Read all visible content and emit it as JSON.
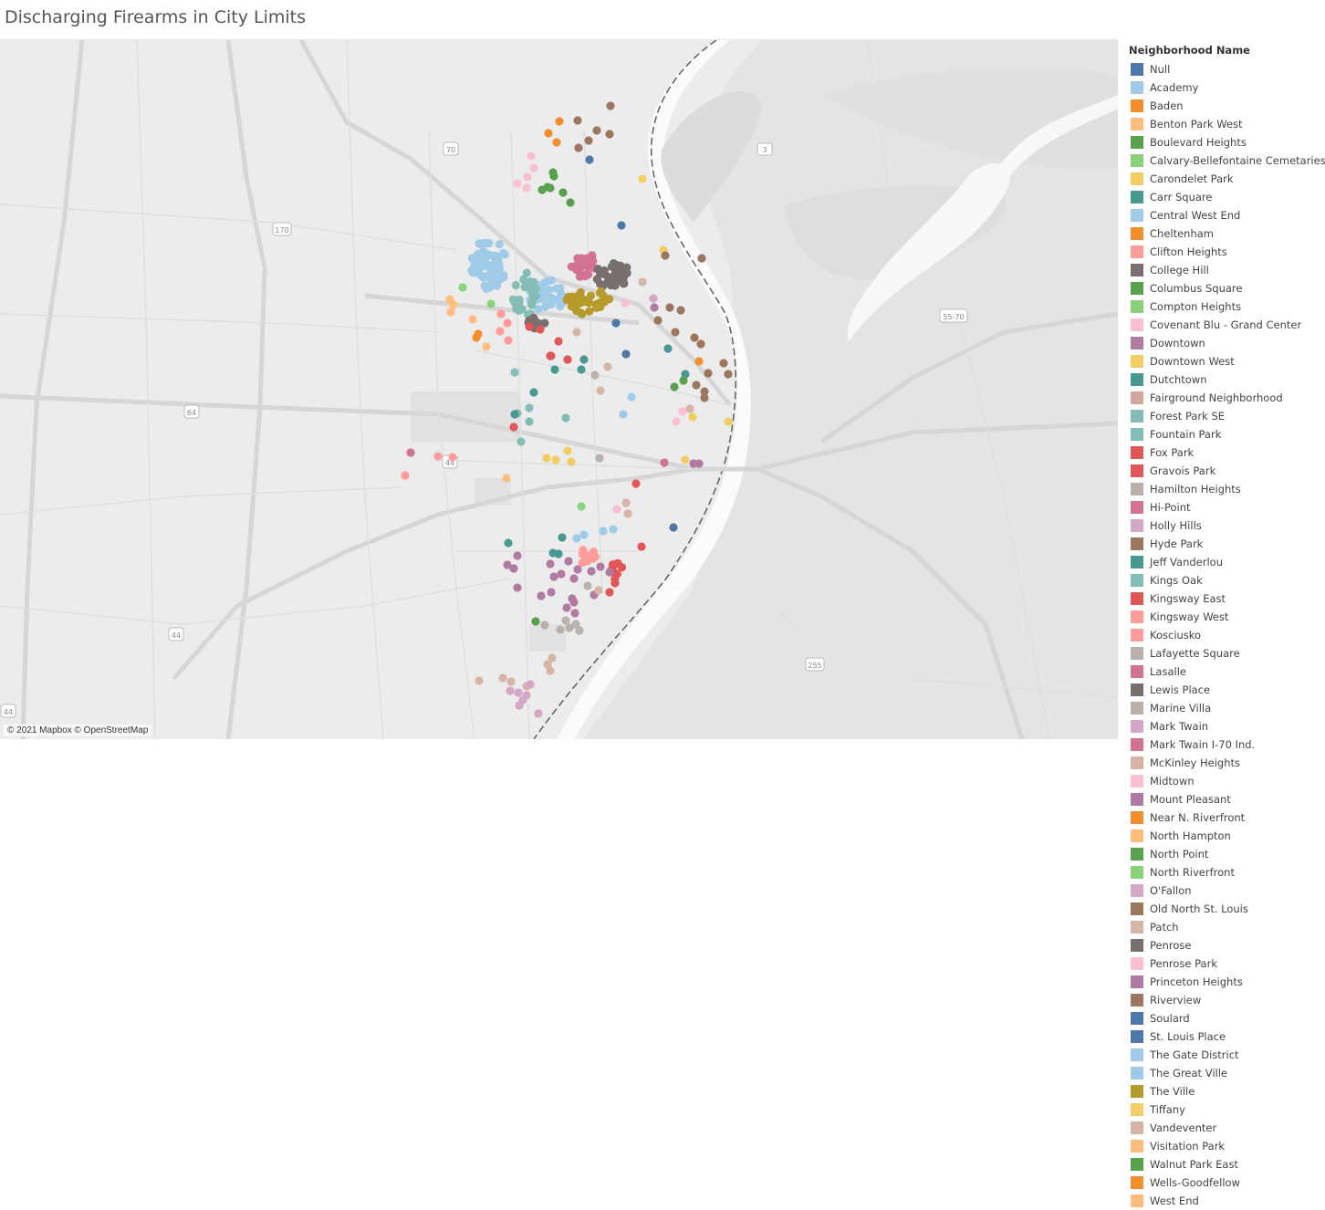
{
  "title": "Discharging Firearms in City Limits",
  "map": {
    "attribution": "© 2021 Mapbox © OpenStreetMap",
    "basemap_labels": {
      "i70": "70",
      "i170": "170",
      "i64": "64",
      "i44_west": "44",
      "i44_city": "44",
      "i44_edge": "44",
      "il3": "3",
      "i5570": "55-70",
      "i255": "255"
    }
  },
  "legend": {
    "title": "Neighborhood Name",
    "items": [
      {
        "label": "Null",
        "color": "#4e79a7"
      },
      {
        "label": "Academy",
        "color": "#a0cbe8"
      },
      {
        "label": "Baden",
        "color": "#f28e2b"
      },
      {
        "label": "Benton Park West",
        "color": "#ffbe7d"
      },
      {
        "label": "Boulevard Heights",
        "color": "#59a14f"
      },
      {
        "label": "Calvary-Bellefontaine Cemetaries",
        "color": "#8cd17d"
      },
      {
        "label": "Carondelet Park",
        "color": "#f1ce63"
      },
      {
        "label": "Carr Square",
        "color": "#499894"
      },
      {
        "label": "Central West End",
        "color": "#a0cbe8"
      },
      {
        "label": "Cheltenham",
        "color": "#f28e2b"
      },
      {
        "label": "Clifton Heights",
        "color": "#ff9d9a"
      },
      {
        "label": "College Hill",
        "color": "#79706e"
      },
      {
        "label": "Columbus Square",
        "color": "#59a14f"
      },
      {
        "label": "Compton Heights",
        "color": "#8cd17d"
      },
      {
        "label": "Covenant Blu - Grand Center",
        "color": "#fabfd2"
      },
      {
        "label": "Downtown",
        "color": "#b07aa1"
      },
      {
        "label": "Downtown West",
        "color": "#f1ce63"
      },
      {
        "label": "Dutchtown",
        "color": "#499894"
      },
      {
        "label": "Fairground Neighborhood",
        "color": "#d4a6a0"
      },
      {
        "label": "Forest Park SE",
        "color": "#86bcb6"
      },
      {
        "label": "Fountain Park",
        "color": "#86bcb6"
      },
      {
        "label": "Fox Park",
        "color": "#e15759"
      },
      {
        "label": "Gravois Park",
        "color": "#e15759"
      },
      {
        "label": "Hamilton Heights",
        "color": "#bab0ac"
      },
      {
        "label": "Hi-Point",
        "color": "#d37295"
      },
      {
        "label": "Holly Hills",
        "color": "#d4a6c8"
      },
      {
        "label": "Hyde Park",
        "color": "#9d7660"
      },
      {
        "label": "Jeff Vanderlou",
        "color": "#499894"
      },
      {
        "label": "Kings Oak",
        "color": "#86bcb6"
      },
      {
        "label": "Kingsway East",
        "color": "#e15759"
      },
      {
        "label": "Kingsway West",
        "color": "#ff9d9a"
      },
      {
        "label": "Kosciusko",
        "color": "#ff9d9a"
      },
      {
        "label": "Lafayette Square",
        "color": "#bab0ac"
      },
      {
        "label": "Lasalle",
        "color": "#d37295"
      },
      {
        "label": "Lewis Place",
        "color": "#79706e"
      },
      {
        "label": "Marine Villa",
        "color": "#bab0ac"
      },
      {
        "label": "Mark Twain",
        "color": "#d4a6c8"
      },
      {
        "label": "Mark Twain I-70 Ind.",
        "color": "#d37295"
      },
      {
        "label": "McKinley Heights",
        "color": "#d7b5a6"
      },
      {
        "label": "Midtown",
        "color": "#fabfd2"
      },
      {
        "label": "Mount Pleasant",
        "color": "#b07aa1"
      },
      {
        "label": "Near N. Riverfront",
        "color": "#f28e2b"
      },
      {
        "label": "North Hampton",
        "color": "#ffbe7d"
      },
      {
        "label": "North Point",
        "color": "#59a14f"
      },
      {
        "label": "North Riverfront",
        "color": "#8cd17d"
      },
      {
        "label": "O'Fallon",
        "color": "#d4a6c8"
      },
      {
        "label": "Old North St. Louis",
        "color": "#9d7660"
      },
      {
        "label": "Patch",
        "color": "#d7b5a6"
      },
      {
        "label": "Penrose",
        "color": "#79706e"
      },
      {
        "label": "Penrose Park",
        "color": "#fabfd2"
      },
      {
        "label": "Princeton Heights",
        "color": "#b07aa1"
      },
      {
        "label": "Riverview",
        "color": "#9d7660"
      },
      {
        "label": "Soulard",
        "color": "#4e79a7"
      },
      {
        "label": "St. Louis Place",
        "color": "#4e79a7"
      },
      {
        "label": "The Gate District",
        "color": "#a0cbe8"
      },
      {
        "label": "The Great Ville",
        "color": "#a0cbe8"
      },
      {
        "label": "The Ville",
        "color": "#b69a2c"
      },
      {
        "label": "Tiffany",
        "color": "#f1ce63"
      },
      {
        "label": "Vandeventer",
        "color": "#d7b5a6"
      },
      {
        "label": "Visitation Park",
        "color": "#ffbe7d"
      },
      {
        "label": "Walnut Park East",
        "color": "#59a14f"
      },
      {
        "label": "Wells-Goodfellow",
        "color": "#f28e2b"
      },
      {
        "label": "West End",
        "color": "#ffbe7d"
      }
    ]
  }
}
